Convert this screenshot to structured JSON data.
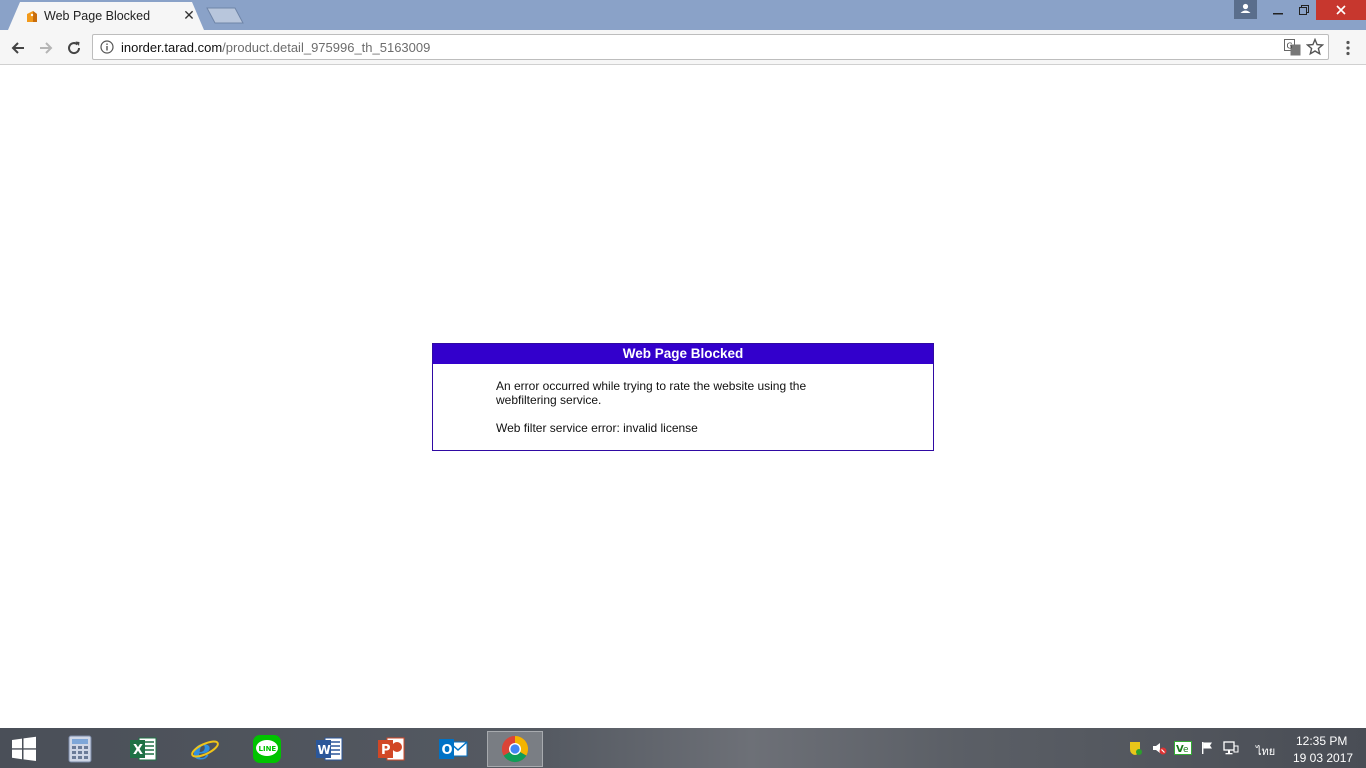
{
  "browser": {
    "tab": {
      "title": "Web Page Blocked"
    },
    "address_bar": {
      "host": "inorder.tarad.com",
      "path": "/product.detail_975996_th_5163009"
    }
  },
  "page": {
    "box_title": "Web Page Blocked",
    "message": "An error occurred while trying to rate the website using the webfiltering service.",
    "error": "Web filter service error: invalid license",
    "colors": {
      "header_bg": "#3300cc",
      "border": "#2f0aa3"
    }
  },
  "taskbar": {
    "apps": [
      "start-icon",
      "calculator-icon",
      "excel-icon",
      "internet-explorer-icon",
      "line-icon",
      "word-icon",
      "powerpoint-icon",
      "outlook-icon",
      "chrome-icon"
    ],
    "active_app": "chrome-icon",
    "tray": {
      "language": "ไทย",
      "time": "12:35 PM",
      "date": "19 03 2017"
    }
  }
}
